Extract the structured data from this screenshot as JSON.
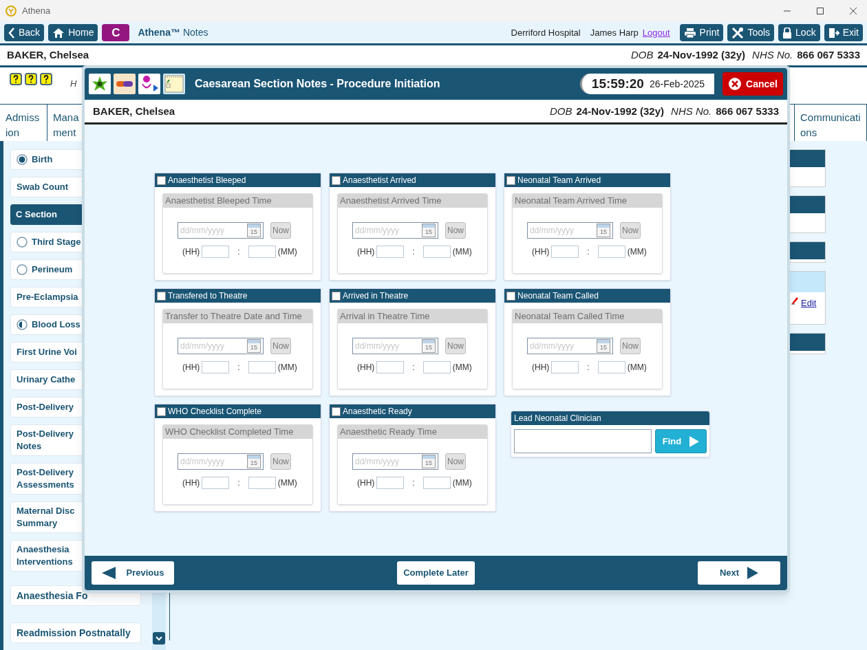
{
  "window": {
    "title": "Athena"
  },
  "toolbar": {
    "nav": [
      {
        "kind": "back",
        "label": "Back"
      },
      {
        "kind": "home",
        "label": "Home"
      },
      {
        "kind": "letter",
        "label": "C"
      }
    ],
    "app_name": "Athena™",
    "app_suffix": "Notes",
    "hospital": "Derriford Hospital",
    "user": "James Harp",
    "logout": "Logout",
    "actions": [
      {
        "kind": "print",
        "label": "Print"
      },
      {
        "kind": "tools",
        "label": "Tools"
      },
      {
        "kind": "lock",
        "label": "Lock"
      },
      {
        "kind": "exit",
        "label": "Exit"
      }
    ]
  },
  "patient": {
    "name": "BAKER, Chelsea",
    "dob_label": "DOB",
    "dob": "24-Nov-1992 (32y)",
    "nhs_label": "NHS No.",
    "nhs": "866 067 5333"
  },
  "alert_text": "H",
  "tabs": [
    {
      "label": "Admission",
      "selected": false
    },
    {
      "label": "Mana ment",
      "selected": false
    },
    {
      "label": "Communications",
      "selected": false
    }
  ],
  "sidebar": [
    {
      "label": "Birth",
      "kind": "complete",
      "selected": false
    },
    {
      "label": "Swab Count",
      "kind": "plain",
      "selected": false
    },
    {
      "label": "C Section",
      "kind": "plain",
      "selected": true
    },
    {
      "label": "Third Stage",
      "kind": "empty",
      "selected": false
    },
    {
      "label": "Perineum",
      "kind": "empty",
      "selected": false
    },
    {
      "label": "Pre-Eclampsia",
      "kind": "plain",
      "selected": false
    },
    {
      "label": "Blood Loss",
      "kind": "partial",
      "selected": false
    },
    {
      "label": "First Urine Voi",
      "kind": "plain",
      "selected": false
    },
    {
      "label": "Urinary Cathe",
      "kind": "plain",
      "selected": false
    },
    {
      "label": "Post-Delivery",
      "kind": "plain",
      "selected": false
    },
    {
      "label": "Post-Delivery Notes",
      "kind": "plain",
      "selected": false
    },
    {
      "label": "Post-Delivery Assessments",
      "kind": "plain",
      "selected": false
    },
    {
      "label": "Maternal Disc Summary",
      "kind": "plain",
      "selected": false
    },
    {
      "label": "Anaesthesia Interventions",
      "kind": "plain",
      "selected": false
    },
    {
      "label": "Anaesthesia Fo",
      "kind": "plain",
      "selected": false
    },
    {
      "label": "Readmission Postnatally",
      "kind": "plain",
      "selected": false
    }
  ],
  "right_panels": [
    {
      "kind": "dark"
    },
    {
      "kind": "dark"
    },
    {
      "kind": "dark_short"
    },
    {
      "kind": "edit",
      "link": "Edit"
    },
    {
      "kind": "dark_short"
    }
  ],
  "dialog": {
    "title": "Caesarean Section Notes - Procedure Initiation",
    "clock": "15:59:20",
    "date": "26-Feb-2025",
    "cancel": "Cancel",
    "patient": {
      "name": "BAKER, Chelsea",
      "dob_label": "DOB",
      "dob": "24-Nov-1992 (32y)",
      "nhs_label": "NHS No.",
      "nhs": "866 067 5333"
    },
    "cards": [
      {
        "kind": "event",
        "label": "Anaesthetist Bleeped",
        "checked": false,
        "disabled": true,
        "time_label": "Anaesthetist Bleeped Time",
        "date_placeholder": "dd/mm/yyyy",
        "calendar_day": "15",
        "now": "Now",
        "hh": "(HH)",
        "separator": ":",
        "mm": "(MM)"
      },
      {
        "kind": "event",
        "label": "Anaesthetist Arrived",
        "checked": false,
        "disabled": true,
        "time_label": "Anaesthetist Arrived Time",
        "date_placeholder": "dd/mm/yyyy",
        "calendar_day": "15",
        "now": "Now",
        "hh": "(HH)",
        "separator": ":",
        "mm": "(MM)"
      },
      {
        "kind": "event",
        "label": "Neonatal Team Arrived",
        "checked": false,
        "disabled": true,
        "time_label": "Neonatal Team Arrived Time",
        "date_placeholder": "dd/mm/yyyy",
        "calendar_day": "15",
        "now": "Now",
        "hh": "(HH)",
        "separator": ":",
        "mm": "(MM)"
      },
      {
        "kind": "event",
        "label": "Transfered to Theatre",
        "checked": false,
        "disabled": true,
        "time_label": "Transfer to Theatre Date and Time",
        "date_placeholder": "dd/mm/yyyy",
        "calendar_day": "15",
        "now": "Now",
        "hh": "(HH)",
        "separator": ":",
        "mm": "(MM)"
      },
      {
        "kind": "event",
        "label": "Arrived in Theatre",
        "checked": false,
        "disabled": true,
        "time_label": "Arrival in Theatre Time",
        "date_placeholder": "dd/mm/yyyy",
        "calendar_day": "15",
        "now": "Now",
        "hh": "(HH)",
        "separator": ":",
        "mm": "(MM)"
      },
      {
        "kind": "event",
        "label": "Neonatal Team Called",
        "checked": false,
        "disabled": true,
        "time_label": "Neonatal Team Called Time",
        "date_placeholder": "dd/mm/yyyy",
        "calendar_day": "15",
        "now": "Now",
        "hh": "(HH)",
        "separator": ":",
        "mm": "(MM)"
      },
      {
        "kind": "event",
        "label": "WHO Checklist Complete",
        "checked": false,
        "disabled": true,
        "time_label": "WHO Checklist Completed Time",
        "date_placeholder": "dd/mm/yyyy",
        "calendar_day": "15",
        "now": "Now",
        "hh": "(HH)",
        "separator": ":",
        "mm": "(MM)"
      },
      {
        "kind": "event",
        "label": "Anaesthetic Ready",
        "checked": false,
        "disabled": true,
        "time_label": "Anaesthetic Ready Time",
        "date_placeholder": "dd/mm/yyyy",
        "calendar_day": "15",
        "now": "Now",
        "hh": "(HH)",
        "separator": ":",
        "mm": "(MM)"
      },
      {
        "kind": "lookup",
        "label": "Lead Neonatal Clinician",
        "find": "Find"
      }
    ],
    "footer": {
      "previous": "Previous",
      "complete_later": "Complete Later",
      "next": "Next"
    }
  }
}
